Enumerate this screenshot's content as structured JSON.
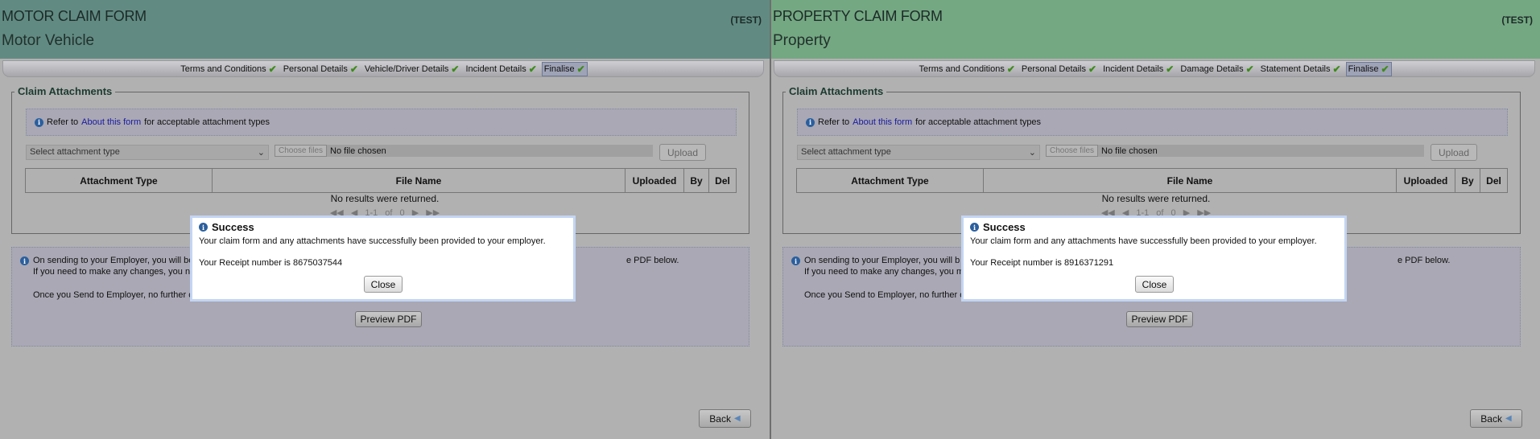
{
  "panels": [
    {
      "header_color": "#618b82",
      "title": "MOTOR CLAIM FORM",
      "subtitle": "Motor Vehicle",
      "env": "(TEST)",
      "steps": [
        "Terms and Conditions",
        "Personal Details",
        "Vehicle/Driver Details",
        "Incident Details",
        "Finalise"
      ],
      "active_step": "Finalise",
      "attachments_legend": "Claim Attachments",
      "info_prefix": "Refer to",
      "info_link": "About this form",
      "info_suffix": "for acceptable attachment types",
      "select_placeholder": "Select attachment type",
      "choose_files": "Choose files",
      "no_file": "No file chosen",
      "upload": "Upload",
      "columns": [
        "Attachment Type",
        "File Name",
        "Uploaded",
        "By",
        "Del"
      ],
      "no_results": "No results were returned.",
      "pager": "1-1 of 0",
      "notice_line1": "On sending to your Employer, you will be",
      "notice_line1_end": "e PDF below.",
      "notice_line2": "If you need to make any changes, you n",
      "notice_line3": "Once you Send to Employer, no further c",
      "preview_pdf": "Preview PDF",
      "back": "Back",
      "modal": {
        "title": "Success",
        "message": "Your claim form and any attachments have successfully been provided to your employer.",
        "receipt": "Your Receipt number is 8675037544",
        "close": "Close"
      }
    },
    {
      "header_color": "#74a882",
      "title": "PROPERTY CLAIM FORM",
      "subtitle": "Property",
      "env": "(TEST)",
      "steps": [
        "Terms and Conditions",
        "Personal Details",
        "Incident Details",
        "Damage Details",
        "Statement Details",
        "Finalise"
      ],
      "active_step": "Finalise",
      "attachments_legend": "Claim Attachments",
      "info_prefix": "Refer to",
      "info_link": "About this form",
      "info_suffix": "for acceptable attachment types",
      "select_placeholder": "Select attachment type",
      "choose_files": "Choose files",
      "no_file": "No file chosen",
      "upload": "Upload",
      "columns": [
        "Attachment Type",
        "File Name",
        "Uploaded",
        "By",
        "Del"
      ],
      "no_results": "No results were returned.",
      "pager": "1-1 of 0",
      "notice_line1": "On sending to your Employer, you will b",
      "notice_line1_end": "e PDF below.",
      "notice_line2": "If you need to make any changes, you m",
      "notice_line3": "Once you Send to Employer, no further c",
      "preview_pdf": "Preview PDF",
      "back": "Back",
      "modal": {
        "title": "Success",
        "message": "Your claim form and any attachments have successfully been provided to your employer.",
        "receipt": "Your Receipt number is 8916371291",
        "close": "Close"
      }
    }
  ]
}
